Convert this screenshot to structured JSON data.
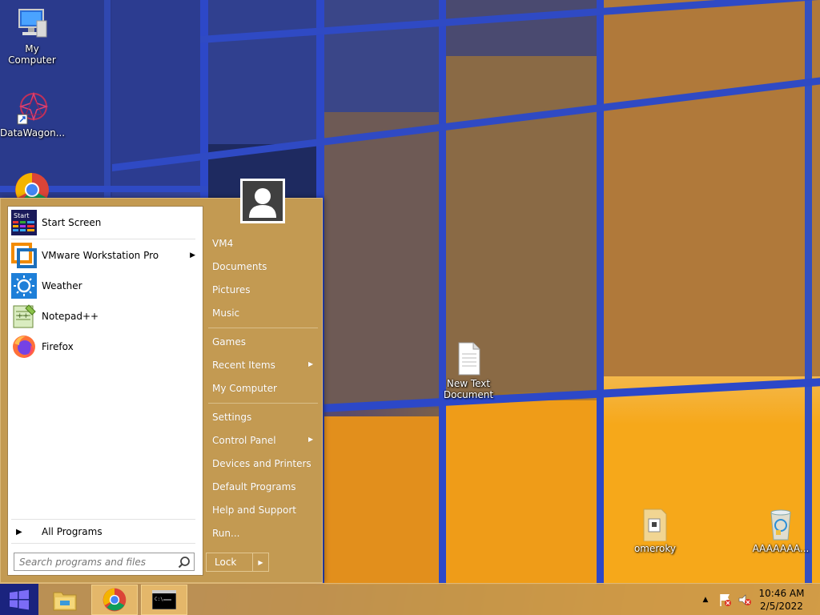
{
  "desktop": {
    "icons": [
      {
        "label": "My Computer"
      },
      {
        "label": "DataWagon..."
      },
      {
        "label": "New Text\nDocument"
      },
      {
        "label": "omeroky"
      },
      {
        "label": "AAAAAAA..."
      }
    ]
  },
  "start_menu": {
    "pinned": [
      {
        "label": "Start Screen",
        "icon": "start-screen-icon"
      },
      {
        "label": "VMware Workstation Pro",
        "icon": "vmware-icon",
        "has_submenu": true
      },
      {
        "label": "Weather",
        "icon": "weather-icon"
      },
      {
        "label": "Notepad++",
        "icon": "notepadpp-icon"
      },
      {
        "label": "Firefox",
        "icon": "firefox-icon"
      }
    ],
    "all_programs": "All Programs",
    "search_placeholder": "Search programs and files",
    "right_items": [
      {
        "label": "VM4"
      },
      {
        "label": "Documents"
      },
      {
        "label": "Pictures"
      },
      {
        "label": "Music"
      },
      {
        "label": "Games"
      },
      {
        "label": "Recent Items"
      },
      {
        "label": "My Computer"
      },
      {
        "label": "Settings"
      },
      {
        "label": "Control Panel"
      },
      {
        "label": "Devices and Printers"
      },
      {
        "label": "Default Programs"
      },
      {
        "label": "Help and Support"
      },
      {
        "label": "Run..."
      }
    ],
    "lock_label": "Lock"
  },
  "taskbar": {
    "time": "10:46 AM",
    "date": "2/5/2022"
  },
  "colors": {
    "menu_bg": "#c39a52",
    "taskbar_bg": "#cd9b4b",
    "accent_blue": "#2d48c8"
  }
}
